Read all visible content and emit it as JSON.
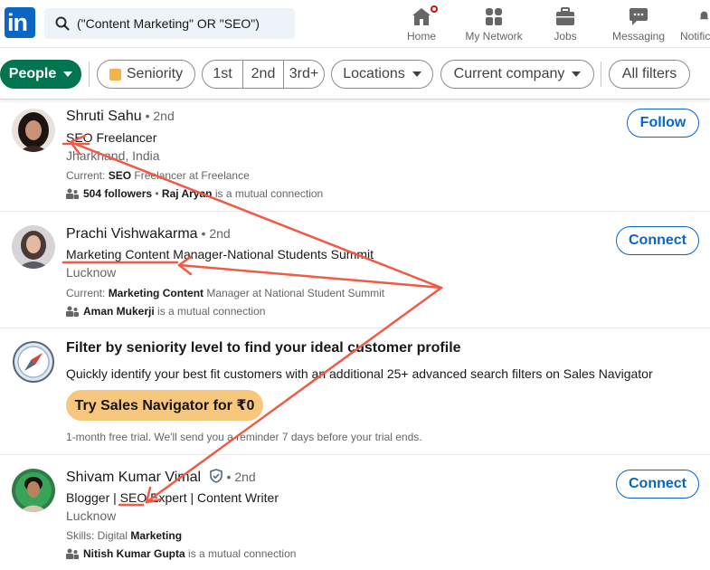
{
  "nav": {
    "search_value": "(\"Content Marketing\" OR \"SEO\")",
    "items": [
      {
        "label": "Home"
      },
      {
        "label": "My Network"
      },
      {
        "label": "Jobs"
      },
      {
        "label": "Messaging"
      },
      {
        "label": "Notific"
      }
    ]
  },
  "filters": {
    "people": "People",
    "seniority": "Seniority",
    "connections": [
      "1st",
      "2nd",
      "3rd+"
    ],
    "locations": "Locations",
    "current_company": "Current company",
    "all_filters": "All filters"
  },
  "results": [
    {
      "name": "Shruti Sahu",
      "degree": "• 2nd",
      "headline": "SEO Freelancer",
      "location": "Jharkhand, India",
      "current_prefix": "Current: ",
      "current_bold": "SEO",
      "current_rest": " Freelancer at Freelance",
      "social_bold_1": "504 followers",
      "social_mid": " • ",
      "social_bold_2": "Raj Aryan",
      "social_rest": " is a mutual connection",
      "action": "Follow"
    },
    {
      "name": "Prachi Vishwakarma",
      "degree": "• 2nd",
      "headline": "Marketing Content Manager-National Students Summit",
      "location": "Lucknow",
      "current_prefix": "Current: ",
      "current_bold": "Marketing Content",
      "current_rest": " Manager at National Student Summit",
      "social_bold_1": "Aman Mukerji",
      "social_rest": " is a mutual connection",
      "action": "Connect"
    },
    {
      "name": "Shivam Kumar Vimal",
      "degree": "• 2nd",
      "headline": "Blogger | SEO Expert | Content Writer",
      "location": "Lucknow",
      "skills_prefix": "Skills: Digital ",
      "skills_bold": "Marketing",
      "social_bold_1": "Nitish Kumar Gupta",
      "social_rest": " is a mutual connection",
      "action": "Connect"
    }
  ],
  "promo": {
    "title": "Filter by seniority level to find your ideal customer profile",
    "text": "Quickly identify your best fit customers with an additional 25+ advanced search filters on Sales Navigator",
    "button": "Try Sales Navigator for ₹0",
    "note": "1-month free trial. We'll send you a reminder 7 days before your trial ends."
  },
  "colors": {
    "brand": "#0a66c2",
    "people_pill": "#01754f",
    "promo_button": "#f8c77e",
    "annotation": "#f05a47"
  }
}
